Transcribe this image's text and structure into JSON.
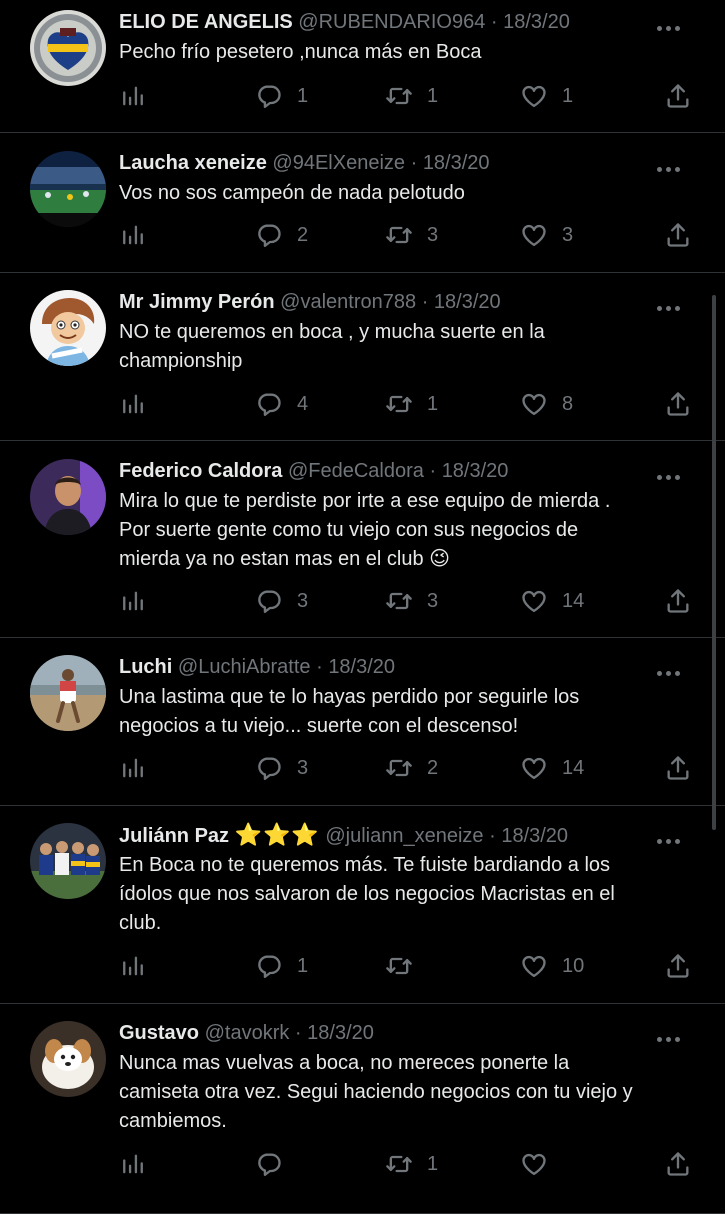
{
  "tweets": [
    {
      "name": "ELIO DE ANGELIS",
      "handle": "@RUBENDARIO964",
      "date": "18/3/20",
      "text": [
        "Pecho frío pesetero ,nunca más en Boca"
      ],
      "replies": "1",
      "retweets": "1",
      "likes": "1",
      "avatar_icon": "boca-heart-avatar"
    },
    {
      "name": "Laucha xeneize",
      "handle": "@94ElXeneize",
      "date": "18/3/20",
      "text": [
        "Vos no sos campeón de nada pelotudo"
      ],
      "replies": "2",
      "retweets": "3",
      "likes": "3",
      "avatar_icon": "stadium-avatar"
    },
    {
      "name": "Mr Jimmy Perón",
      "handle": "@valentron788",
      "date": "18/3/20",
      "text": [
        "NO te queremos en boca , y mucha suerte en la",
        "championship"
      ],
      "replies": "4",
      "retweets": "1",
      "likes": "8",
      "avatar_icon": "cartoon-avatar"
    },
    {
      "name": "Federico Caldora",
      "handle": "@FedeCaldora",
      "date": "18/3/20",
      "text": [
        "Mira lo que te perdiste por irte a ese equipo de mierda .",
        "Por suerte gente como tu viejo con sus negocios de",
        "mierda ya no estan mas en el club 😉"
      ],
      "replies": "3",
      "retweets": "3",
      "likes": "14",
      "avatar_icon": "person-avatar"
    },
    {
      "name": "Luchi",
      "handle": "@LuchiAbratte",
      "date": "18/3/20",
      "text": [
        "Una lastima que te lo hayas perdido por seguirle los",
        "negocios a tu viejo... suerte con el descenso!"
      ],
      "replies": "3",
      "retweets": "2",
      "likes": "14",
      "avatar_icon": "beach-avatar"
    },
    {
      "name": "Juliánn Paz",
      "stars": "⭐⭐⭐",
      "handle": "@juliann_xeneize",
      "date": "18/3/20",
      "text": [
        "En Boca no te queremos más. Te fuiste bardiando a los",
        "ídolos que nos salvaron de los negocios Macristas en el",
        "club."
      ],
      "replies": "1",
      "retweets": "",
      "likes": "10",
      "avatar_icon": "group-avatar"
    },
    {
      "name": "Gustavo",
      "handle": "@tavokrk",
      "date": "18/3/20",
      "text": [
        "Nunca mas vuelvas a boca, no mereces ponerte la",
        "camiseta otra vez. Segui haciendo negocios con tu viejo y",
        "cambiemos."
      ],
      "replies": "",
      "retweets": "1",
      "likes": "",
      "avatar_icon": "dog-avatar"
    }
  ],
  "separator": "·",
  "colors": {
    "background": "#000000",
    "text": "#e7e9ea",
    "muted": "#71767b",
    "divider": "#2f3336"
  }
}
